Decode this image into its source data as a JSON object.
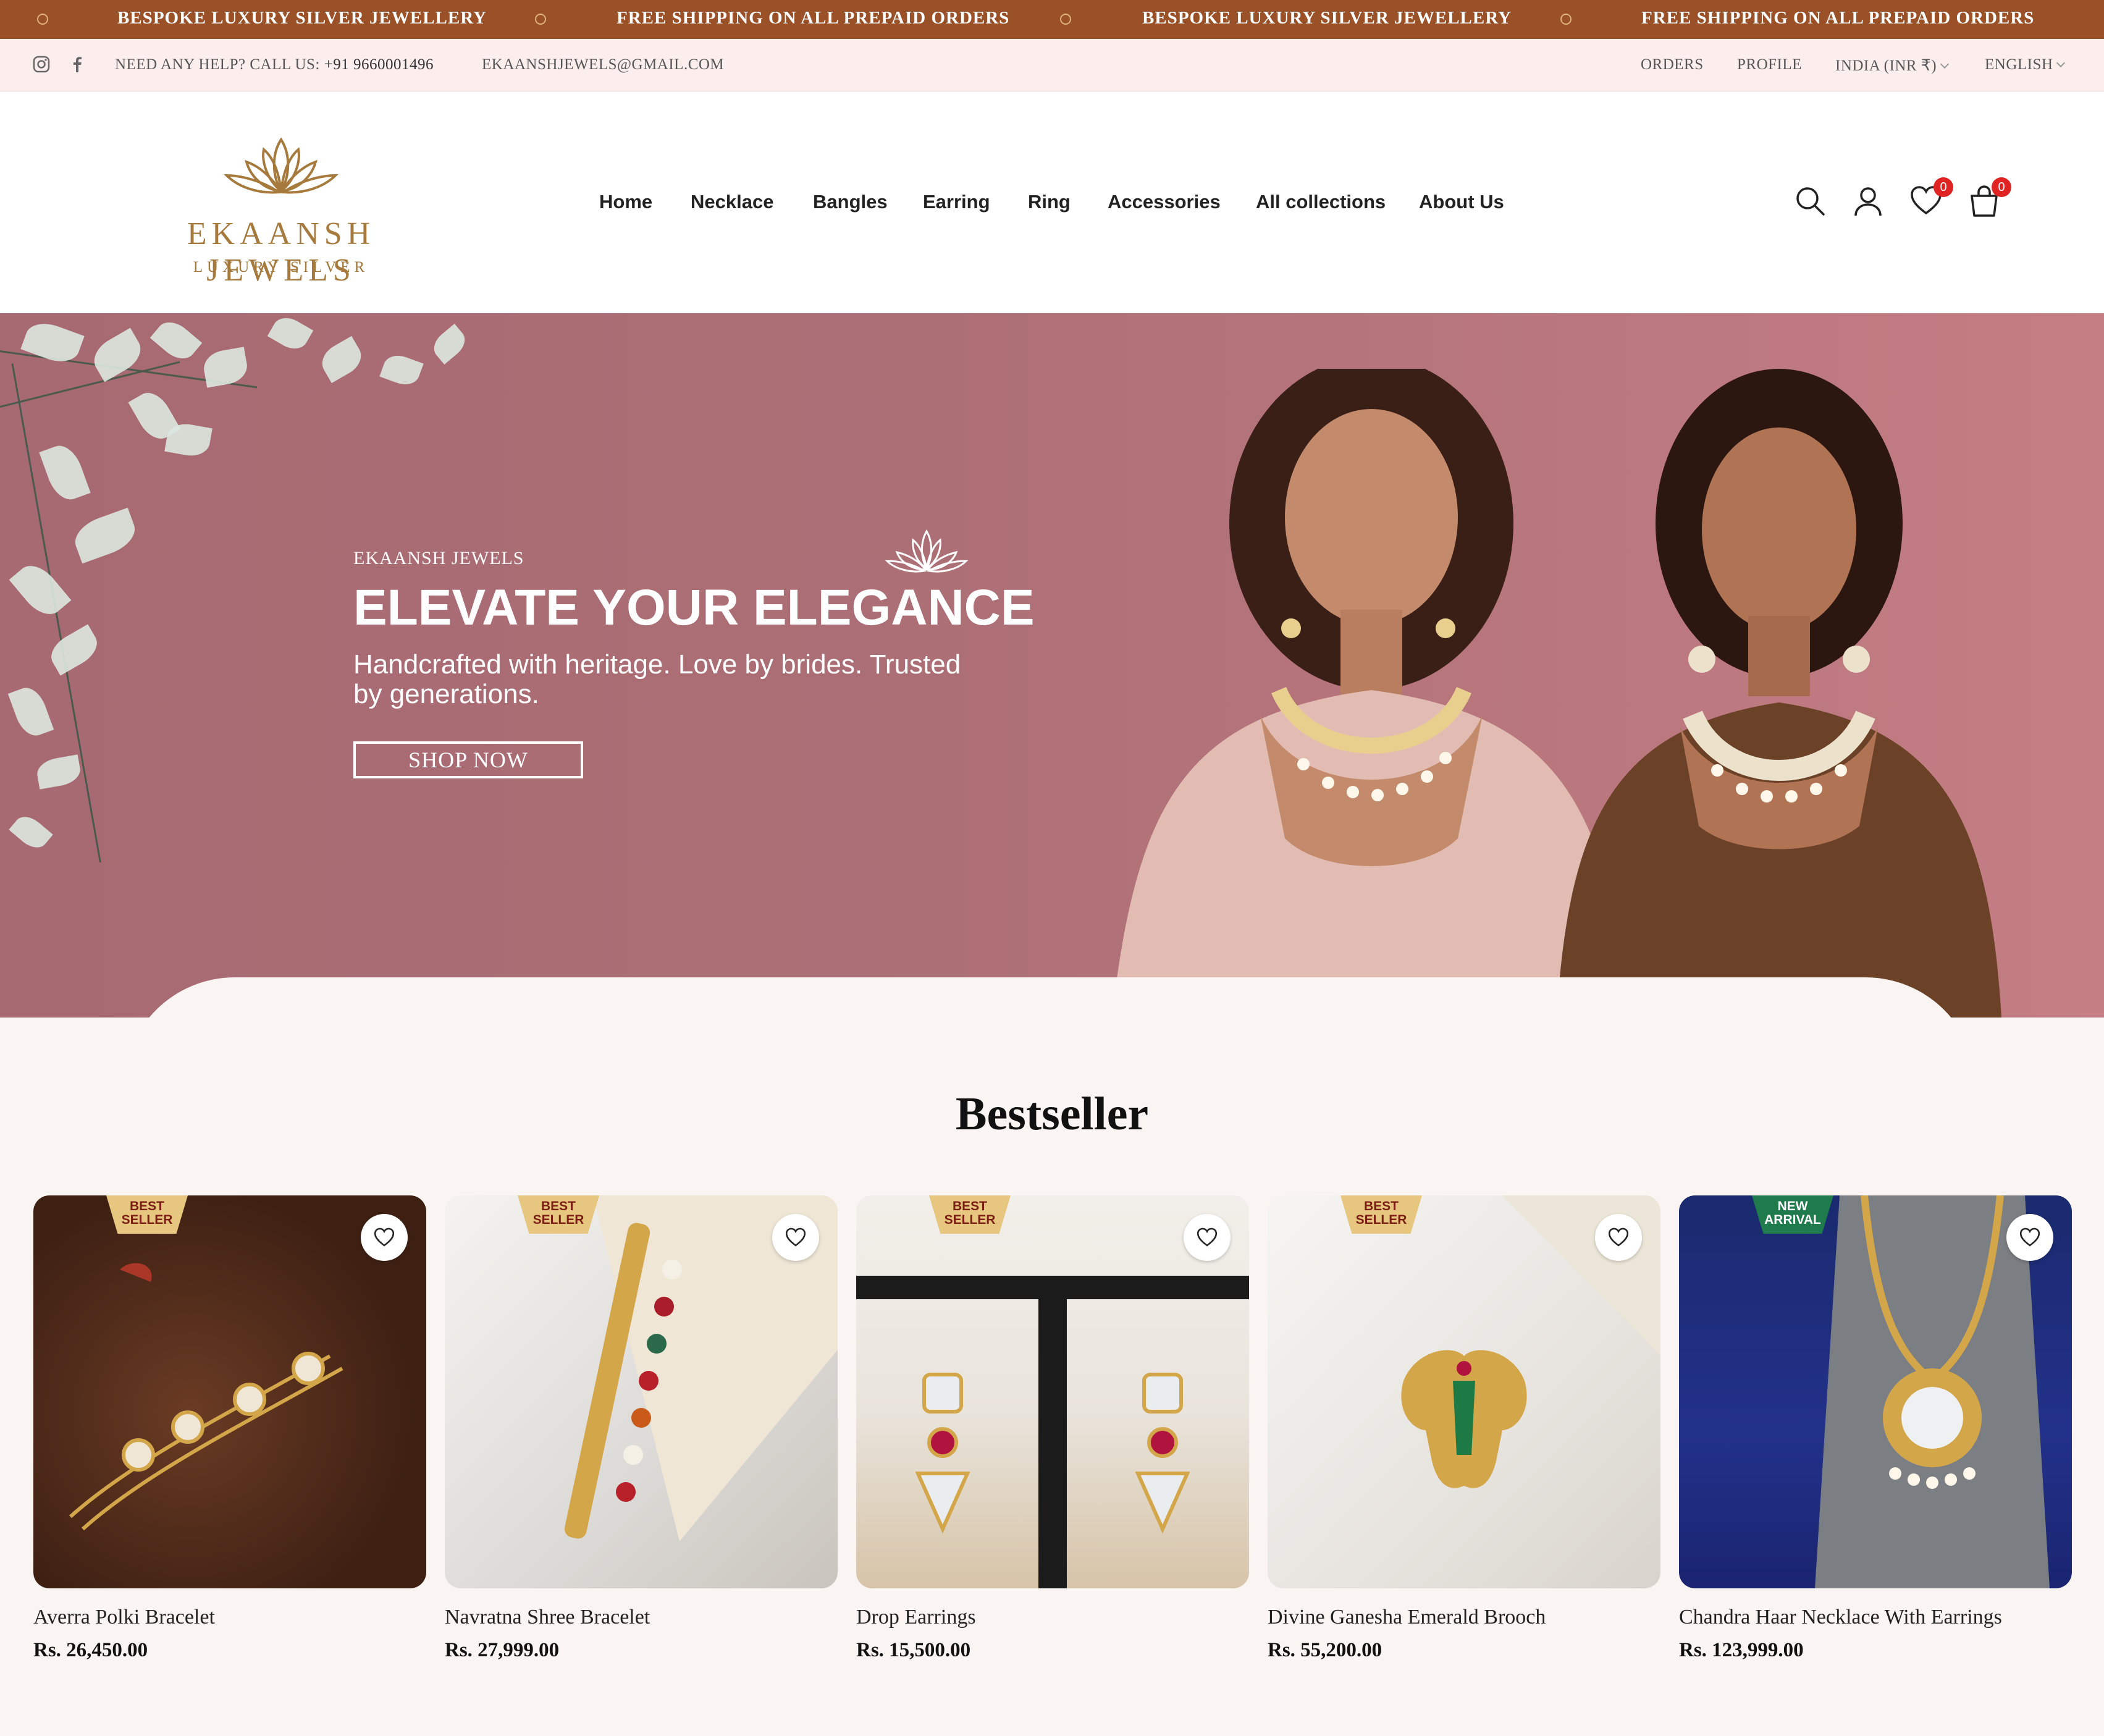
{
  "announcement": {
    "messages": [
      "BESPOKE LUXURY SILVER JEWELLERY",
      "FREE SHIPPING ON ALL PREPAID ORDERS",
      "BESPOKE LUXURY SILVER JEWELLERY",
      "FREE SHIPPING ON ALL PREPAID ORDERS"
    ]
  },
  "utility": {
    "help_label": "NEED ANY HELP? CALL US:",
    "phone": "+91 9660001496",
    "email": "EKAANSHJEWELS@GMAIL.COM",
    "orders": "ORDERS",
    "profile": "PROFILE",
    "currency": "INDIA (INR ₹)",
    "language": "ENGLISH",
    "social_icons": [
      "instagram-icon",
      "facebook-icon"
    ]
  },
  "header": {
    "brand": "EKAANSH JEWELS",
    "tagline": "LUXURY SILVER",
    "nav": [
      "Home",
      "Necklace",
      "Bangles",
      "Earring",
      "Ring",
      "Accessories",
      "All collections",
      "About Us"
    ],
    "wishlist_count": "0",
    "cart_count": "0",
    "icons": [
      "search-icon",
      "account-icon",
      "heart-icon",
      "bag-icon"
    ]
  },
  "hero": {
    "kicker": "EKAANSH   JEWELS",
    "title": "ELEVATE YOUR ELEGANCE",
    "subtitle": "Handcrafted with heritage. Love by brides. Trusted by generations.",
    "cta": "SHOP NOW"
  },
  "bestseller": {
    "title": "Bestseller",
    "products": [
      {
        "badge": "BEST SELLER",
        "name": "Averra Polki Bracelet",
        "price": "Rs. 26,450.00"
      },
      {
        "badge": "BEST SELLER",
        "name": "Navratna Shree Bracelet",
        "price": "Rs. 27,999.00"
      },
      {
        "badge": "BEST SELLER",
        "name": "Drop Earrings",
        "price": "Rs. 15,500.00"
      },
      {
        "badge": "BEST SELLER",
        "name": "Divine Ganesha Emerald Brooch",
        "price": "Rs. 55,200.00"
      },
      {
        "badge": "NEW ARRIVAL",
        "name": "Chandra Haar Necklace With Earrings",
        "price": "Rs. 123,999.00"
      }
    ]
  },
  "colors": {
    "announcement_bg": "#9b5128",
    "utility_bg": "#fdeeee",
    "hero_bg": "#ad6f76",
    "brand_gold": "#a67a3d",
    "badge_red": "#e02424"
  }
}
